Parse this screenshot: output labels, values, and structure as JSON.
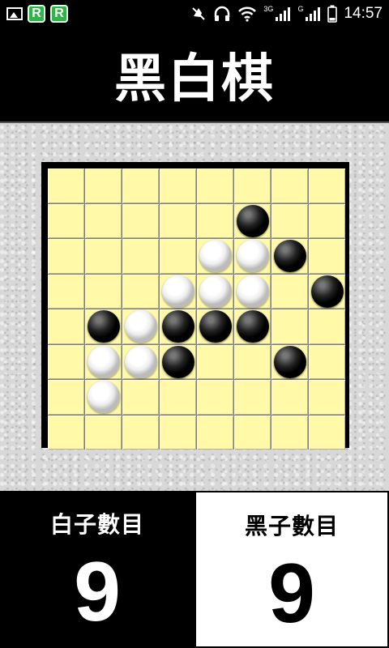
{
  "status_bar": {
    "time": "14:57",
    "net_3g": "3G",
    "net_g": "G",
    "icons": [
      "image-icon",
      "r-app-icon",
      "r-app-icon",
      "mute-icon",
      "headphones-icon",
      "wifi-icon",
      "signal-icon",
      "signal-icon",
      "battery-icon"
    ]
  },
  "app": {
    "title": "黑白棋"
  },
  "board": {
    "size": 8,
    "cells": [
      [
        null,
        null,
        null,
        null,
        null,
        null,
        null,
        null
      ],
      [
        null,
        null,
        null,
        null,
        null,
        "black",
        null,
        null
      ],
      [
        null,
        null,
        null,
        null,
        "white",
        "white",
        "black",
        null
      ],
      [
        null,
        null,
        null,
        "white",
        "white",
        "white",
        null,
        "black"
      ],
      [
        null,
        "black",
        "white",
        "black",
        "black",
        "black",
        null,
        null
      ],
      [
        null,
        "white",
        "white",
        "black",
        null,
        null,
        "black",
        null
      ],
      [
        null,
        "white",
        null,
        null,
        null,
        null,
        null,
        null
      ],
      [
        null,
        null,
        null,
        null,
        null,
        null,
        null,
        null
      ]
    ],
    "colors": {
      "cell": "#fff9a8",
      "frame": "#000000"
    }
  },
  "scores": {
    "white": {
      "label": "白子數目",
      "value": "9"
    },
    "black": {
      "label": "黑子數目",
      "value": "9"
    }
  }
}
